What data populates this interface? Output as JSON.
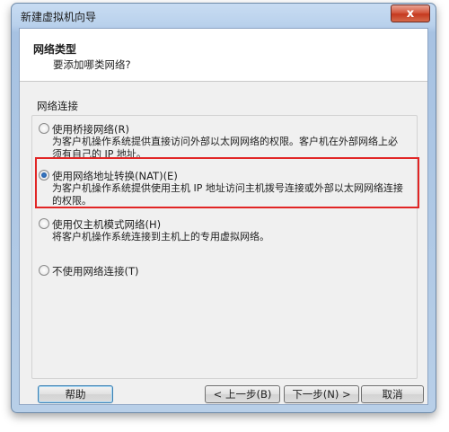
{
  "window": {
    "title": "新建虚拟机向导",
    "close_label": "x"
  },
  "header": {
    "title": "网络类型",
    "subtitle": "要添加哪类网络?"
  },
  "group": {
    "title": "网络连接"
  },
  "options": [
    {
      "label": "使用桥接网络(R)",
      "desc": "为客户机操作系统提供直接访问外部以太网网络的权限。客户机在外部网络上必须有自己的 IP 地址。",
      "checked": false
    },
    {
      "label": "使用网络地址转换(NAT)(E)",
      "desc": "为客户机操作系统提供使用主机 IP 地址访问主机拨号连接或外部以太网网络连接的权限。",
      "checked": true
    },
    {
      "label": "使用仅主机模式网络(H)",
      "desc": "将客户机操作系统连接到主机上的专用虚拟网络。",
      "checked": false
    },
    {
      "label": "不使用网络连接(T)",
      "desc": "",
      "checked": false
    }
  ],
  "buttons": {
    "help": "帮助",
    "back": "< 上一步(B)",
    "next": "下一步(N) >",
    "cancel": "取消"
  }
}
